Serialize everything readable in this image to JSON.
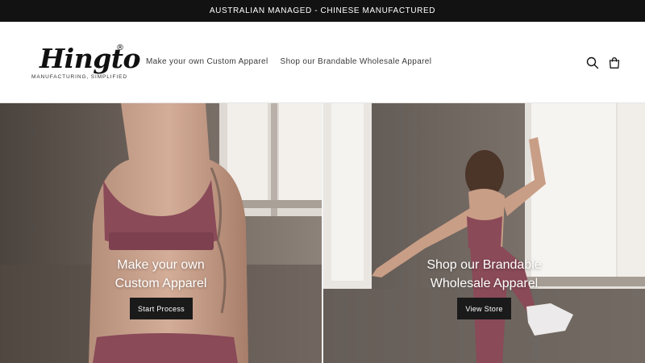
{
  "announcement": {
    "text": "AUSTRALIAN MANAGED - CHINESE MANUFACTURED"
  },
  "header": {
    "logo": {
      "word": "Hingto",
      "registered": "®",
      "tagline": "MANUFACTURING, SIMPLIFIED"
    },
    "nav": [
      {
        "label": "Make your own Custom Apparel"
      },
      {
        "label": "Shop our Brandable Wholesale Apparel"
      }
    ],
    "icons": {
      "search": "search-icon",
      "cart": "cart-icon"
    }
  },
  "hero": {
    "left": {
      "line1": "Make your own",
      "line2": "Custom Apparel",
      "button": "Start Process"
    },
    "right": {
      "line1": "Shop our Brandable",
      "line2": "Wholesale Apparel",
      "button": "View Store"
    }
  },
  "colors": {
    "announcement_bg": "#121212",
    "button_bg": "#1a1a1a",
    "apparel_mauve": "#8a4a58"
  }
}
